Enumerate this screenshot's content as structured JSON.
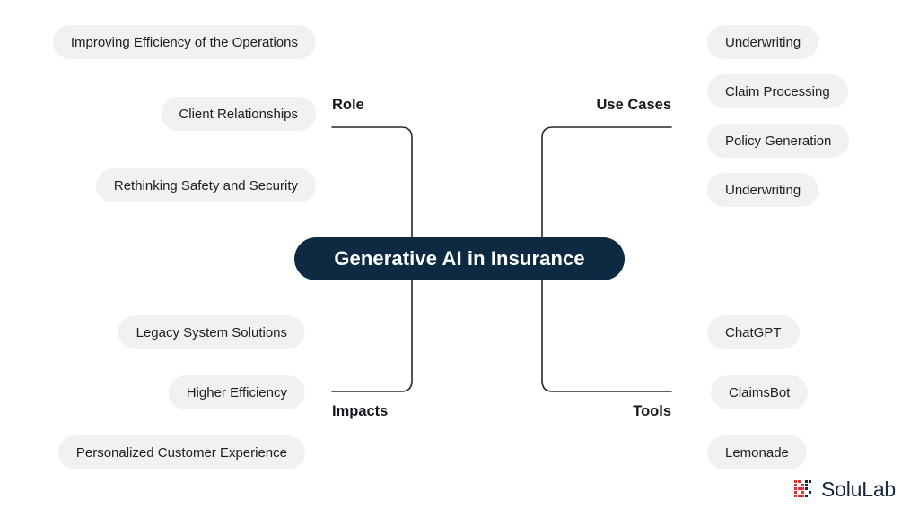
{
  "diagram": {
    "center": {
      "label": "Generative AI in Insurance",
      "color": "#0d2a42"
    },
    "branches": {
      "role": {
        "label": "Role"
      },
      "use_cases": {
        "label": "Use Cases"
      },
      "impacts": {
        "label": "Impacts"
      },
      "tools": {
        "label": "Tools"
      }
    },
    "nodes": {
      "role": [
        {
          "label": "Improving Efficiency of the Operations"
        },
        {
          "label": "Client Relationships"
        },
        {
          "label": "Rethinking Safety and Security"
        }
      ],
      "use_cases": [
        {
          "label": "Underwriting"
        },
        {
          "label": "Claim Processing"
        },
        {
          "label": "Policy Generation"
        },
        {
          "label": "Underwriting"
        }
      ],
      "impacts": [
        {
          "label": "Legacy System Solutions"
        },
        {
          "label": "Higher Efficiency"
        },
        {
          "label": "Personalized Customer Experience"
        }
      ],
      "tools": [
        {
          "label": "ChatGPT"
        },
        {
          "label": "ClaimsBot"
        },
        {
          "label": "Lemonade"
        }
      ]
    }
  },
  "branding": {
    "name": "SoluLab",
    "mark_color": "#e03030",
    "text_color": "#17283c"
  },
  "theme": {
    "background": "#ffffff",
    "pill_background": "#f1f1f2",
    "pill_text": "#1b1f23",
    "connector": "#23282d"
  }
}
